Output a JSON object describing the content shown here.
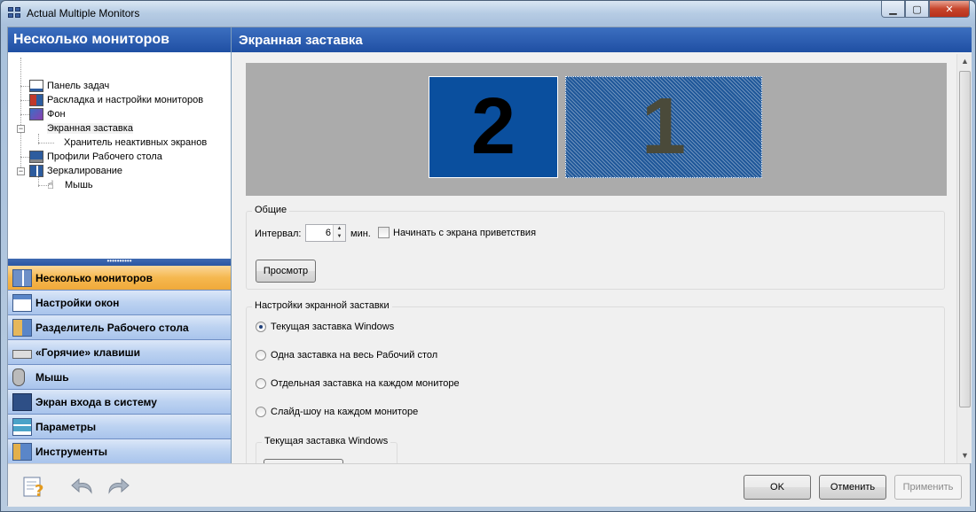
{
  "window": {
    "title": "Actual Multiple Monitors"
  },
  "left_panel": {
    "header": "Несколько мониторов",
    "tree": [
      {
        "label": "Панель задач"
      },
      {
        "label": "Раскладка и настройки мониторов"
      },
      {
        "label": "Фон"
      },
      {
        "label": "Экранная заставка"
      },
      {
        "label": "Хранитель неактивных экранов"
      },
      {
        "label": "Профили Рабочего стола"
      },
      {
        "label": "Зеркалирование"
      },
      {
        "label": "Мышь"
      }
    ],
    "splitter": "••••••••••",
    "nav": [
      {
        "label": "Несколько мониторов"
      },
      {
        "label": "Настройки окон"
      },
      {
        "label": "Разделитель Рабочего стола"
      },
      {
        "label": "«Горячие» клавиши"
      },
      {
        "label": "Мышь"
      },
      {
        "label": "Экран входа в систему"
      },
      {
        "label": "Параметры"
      },
      {
        "label": "Инструменты"
      }
    ],
    "more": "»"
  },
  "right_panel": {
    "header": "Экранная заставка",
    "monitors": {
      "left_number": "2",
      "right_number": "1"
    },
    "general": {
      "title": "Общие",
      "interval_label": "Интервал:",
      "interval_value": "6",
      "interval_unit": "мин.",
      "welcome_checkbox": "Начинать с экрана приветствия",
      "welcome_checked": false,
      "preview_button": "Просмотр"
    },
    "screensaver_settings": {
      "title": "Настройки экранной заставки",
      "options": [
        {
          "label": "Текущая заставка Windows",
          "selected": true
        },
        {
          "label": "Одна заставка на весь Рабочий стол",
          "selected": false
        },
        {
          "label": "Отдельная заставка на каждом мониторе",
          "selected": false
        },
        {
          "label": "Слайд-шоу на каждом мониторе",
          "selected": false
        }
      ],
      "sub_group_title": "Текущая заставка Windows"
    }
  },
  "bottom": {
    "ok": "OK",
    "cancel": "Отменить",
    "apply": "Применить"
  }
}
